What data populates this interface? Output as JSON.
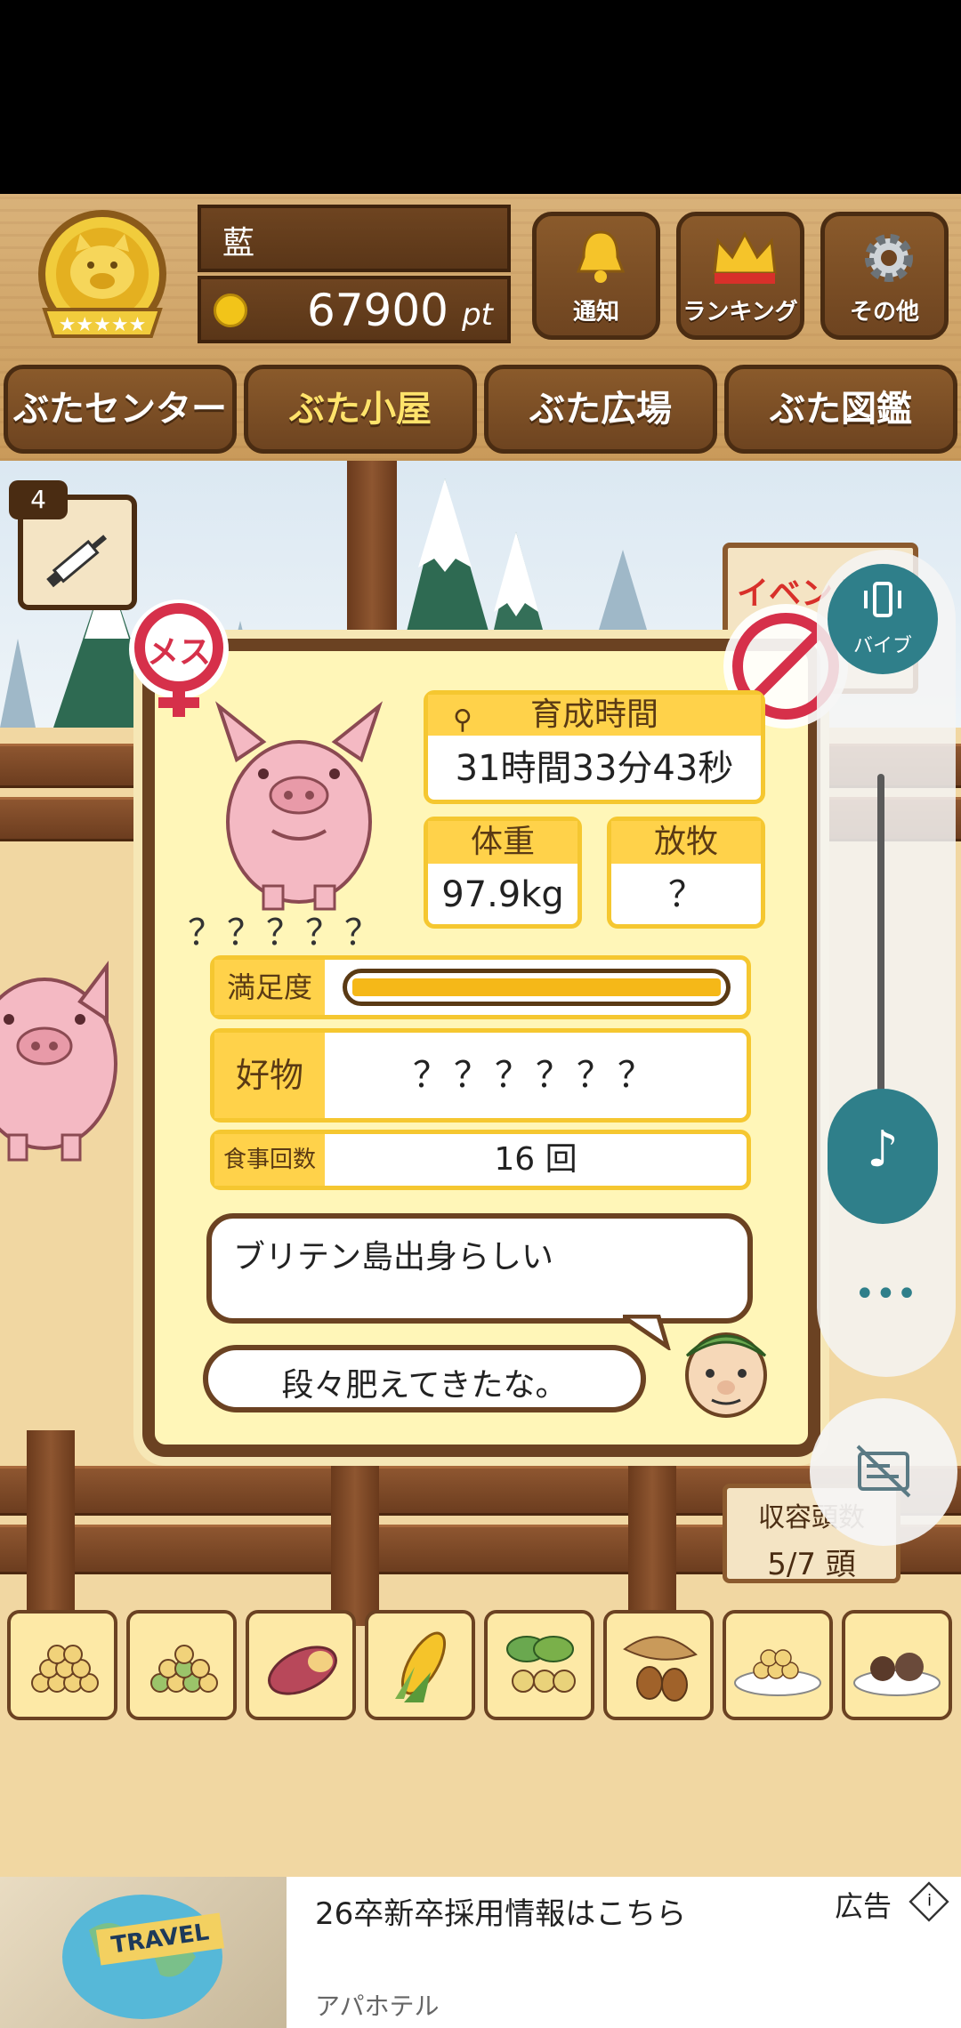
{
  "player": {
    "name": "藍",
    "points": "67900",
    "points_unit": "pt"
  },
  "header_buttons": [
    {
      "label": "通知",
      "icon": "bell-icon"
    },
    {
      "label": "ランキング",
      "icon": "crown-icon"
    },
    {
      "label": "その他",
      "icon": "gear-icon"
    }
  ],
  "tabs": [
    {
      "label": "ぶたセンター",
      "active": false
    },
    {
      "label": "ぶた小屋",
      "active": true
    },
    {
      "label": "ぶた広場",
      "active": false
    },
    {
      "label": "ぶた図鑑",
      "active": false
    }
  ],
  "syringe": {
    "count": "4"
  },
  "event_sign": "イベント",
  "pig": {
    "gender": "メス",
    "name": "？？？？？",
    "growth_label": "育成時間",
    "growth_value": "31時間33分43秒",
    "weight_label": "体重",
    "weight_value": "97.9kg",
    "release_label": "放牧",
    "release_value": "？",
    "satisfaction_label": "満足度",
    "satisfaction_level": 1.0,
    "favorite_label": "好物",
    "favorite_value": "？？？？？？",
    "meals_label": "食事回数",
    "meals_value": "16 回",
    "origin_text": "ブリテン島出身らしい",
    "farmer_comment": "段々肥えてきたな。"
  },
  "capacity": {
    "label": "収容頭数",
    "value": "5/7 頭"
  },
  "side_controls": {
    "vibrate_label": "バイブ"
  },
  "foods": [
    "beans-icon",
    "mixed-beans-icon",
    "sweet-potato-icon",
    "corn-icon",
    "soybean-icon",
    "acorn-icon",
    "grain-plate-icon",
    "meat-plate-icon"
  ],
  "ad": {
    "title": "26卒新卒採用情報はこちら",
    "advertiser": "アパホテル",
    "ad_label": "広告",
    "image_text": "TRAVEL"
  },
  "colors": {
    "accent": "#ffd24a",
    "wood": "#6b4222",
    "gender": "#d6304a"
  }
}
